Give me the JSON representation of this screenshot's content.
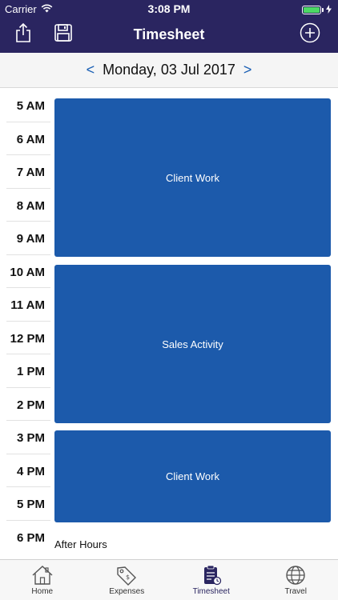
{
  "status_bar": {
    "carrier": "Carrier",
    "time": "3:08 PM"
  },
  "nav": {
    "title": "Timesheet",
    "left_icons": [
      "share-icon",
      "save-icon"
    ],
    "right_icon": "add-icon"
  },
  "date_bar": {
    "prev": "<",
    "date": "Monday, 03 Jul 2017",
    "next": ">"
  },
  "hours": [
    "5 AM",
    "6 AM",
    "7 AM",
    "8 AM",
    "9 AM",
    "10 AM",
    "11 AM",
    "12 PM",
    "1 PM",
    "2 PM",
    "3 PM",
    "4 PM",
    "5 PM",
    "6 PM"
  ],
  "events": [
    {
      "label": "Client Work",
      "start": "5 AM",
      "end": "10 AM"
    },
    {
      "label": "Sales Activity",
      "start": "10 AM",
      "end": "3 PM"
    },
    {
      "label": "Client Work",
      "start": "3 PM",
      "end": "6 PM"
    }
  ],
  "after_hours_label": "After Hours",
  "tabs": [
    {
      "label": "Home",
      "icon": "home-icon"
    },
    {
      "label": "Expenses",
      "icon": "expenses-tag-icon"
    },
    {
      "label": "Timesheet",
      "icon": "timesheet-clipboard-icon",
      "active": true
    },
    {
      "label": "Travel",
      "icon": "globe-icon"
    }
  ],
  "colors": {
    "header": "#2a2560",
    "event": "#1c5aab",
    "accent": "#1a5fb4",
    "battery": "#4cd964"
  }
}
